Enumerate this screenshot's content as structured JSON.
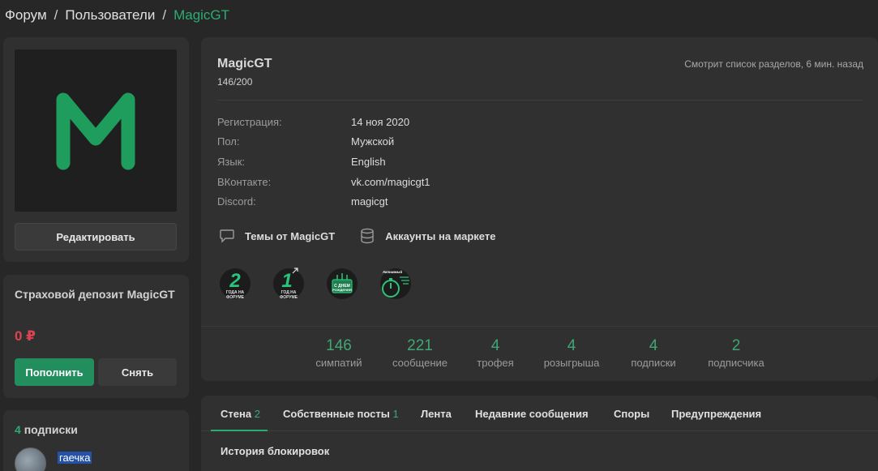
{
  "breadcrumb": {
    "forum": "Форум",
    "sep1": "/",
    "users": "Пользователи",
    "sep2": "/",
    "current": "MagicGT"
  },
  "avatar": {
    "letter": "M",
    "color": "#1f9d5c"
  },
  "edit_button": "Редактировать",
  "deposit": {
    "title": "Страховой депозит MagicGT",
    "amount": "0 ₽",
    "topup": "Пополнить",
    "withdraw": "Снять"
  },
  "subscriptions": {
    "count": "4",
    "label": "подписки",
    "items": [
      {
        "name": "гаечка"
      }
    ]
  },
  "profile": {
    "username": "MagicGT",
    "rank": "146/200",
    "last_seen": "Смотрит список разделов, 6 мин. назад",
    "info": [
      {
        "label": "Регистрация:",
        "value": "14 ноя 2020"
      },
      {
        "label": "Пол:",
        "value": "Мужской"
      },
      {
        "label": "Язык:",
        "value": "English"
      },
      {
        "label": "ВКонтакте:",
        "value": "vk.com/magicgt1"
      },
      {
        "label": "Discord:",
        "value": "magicgt"
      }
    ],
    "links": {
      "threads": "Темы от MagicGT",
      "market": "Аккаунты на маркете"
    },
    "trophies": [
      {
        "number": "2",
        "line1": "ГОДА НА",
        "line2": "ФОРУМЕ"
      },
      {
        "number": "1",
        "line1": "ГОД НА",
        "line2": "ФОРУМЕ"
      },
      {
        "line1": "С ДНЕМ",
        "line2": "РОЖДЕНИЯ"
      },
      {
        "line1": "Активный"
      }
    ],
    "stats": [
      {
        "num": "146",
        "label": "симпатий"
      },
      {
        "num": "221",
        "label": "сообщение"
      },
      {
        "num": "4",
        "label": "трофея"
      },
      {
        "num": "4",
        "label": "розыгрыша"
      },
      {
        "num": "4",
        "label": "подписки"
      },
      {
        "num": "2",
        "label": "подписчика"
      }
    ]
  },
  "tabs": {
    "wall": "Стена",
    "wall_count": "2",
    "own_posts": "Собственные посты",
    "own_posts_count": "1",
    "feed": "Лента",
    "recent": "Недавние сообщения",
    "disputes": "Споры",
    "warnings": "Предупреждения",
    "bans": "История блокировок"
  },
  "colors": {
    "accent": "#2bad72",
    "deposit_amount": "#e0434f",
    "background": "#272727",
    "panel": "#303030"
  }
}
